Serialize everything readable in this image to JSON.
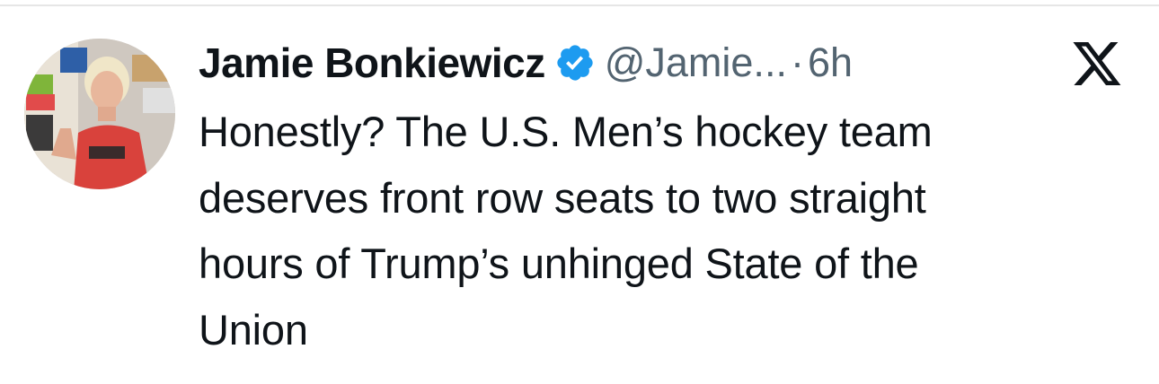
{
  "author": {
    "display_name": "Jamie Bonkiewicz",
    "handle": "@Jamie...",
    "verified_icon": "verified-check-icon",
    "badge_color": "#1d9bf0"
  },
  "separator": "·",
  "timestamp": "6h",
  "platform_icon": "x-logo-icon",
  "tweet": {
    "text": "Honestly? The U.S. Men’s hockey team\ndeserves front row seats to two straight\nhours of Trump’s unhinged State of the\nUnion"
  }
}
